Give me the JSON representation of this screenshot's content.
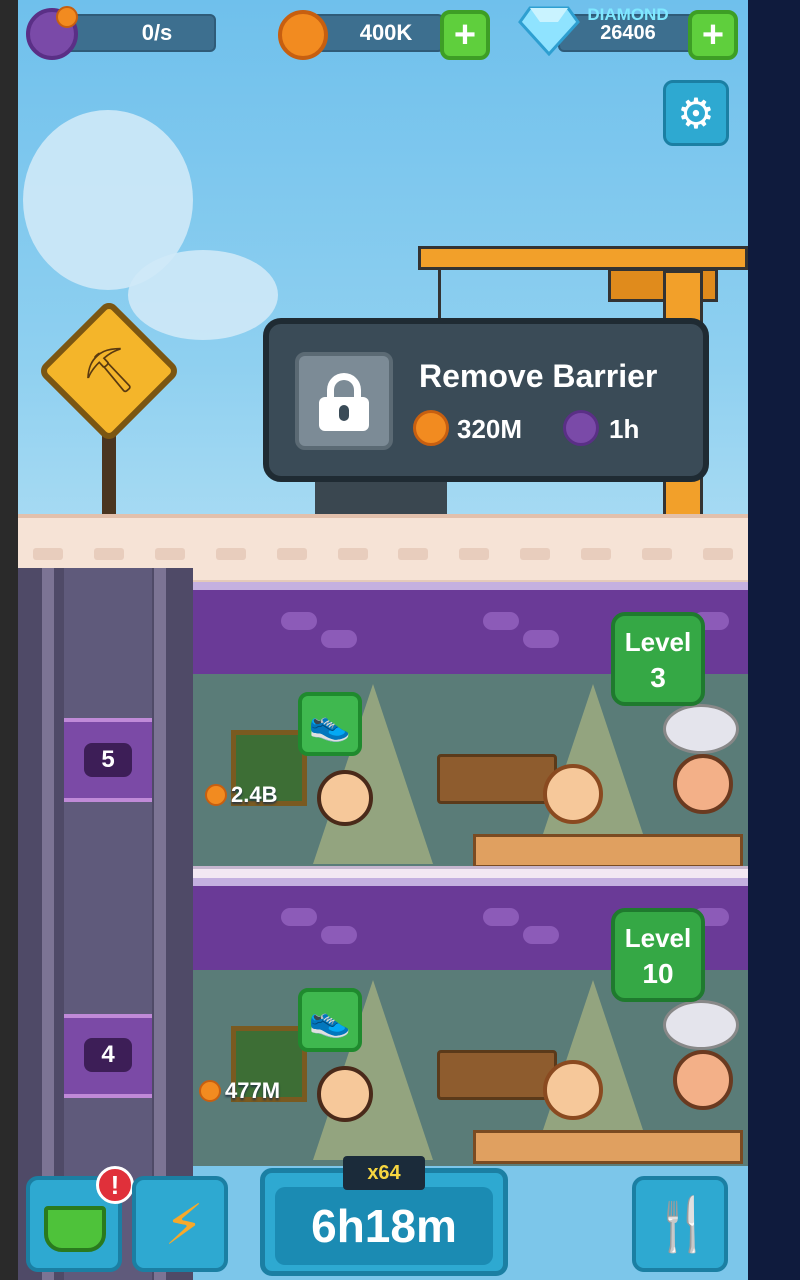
{
  "hud": {
    "income_rate": "0/s",
    "coins": "400K",
    "diamond_label": "DIAMOND",
    "diamonds": "26406",
    "plus": "+"
  },
  "barrier": {
    "title": "Remove Barrier",
    "cost": "320M",
    "time": "1h"
  },
  "floors": [
    {
      "number": "5",
      "level_label": "Level",
      "level": "3",
      "earning": "2.4B"
    },
    {
      "number": "4",
      "level_label": "Level",
      "level": "10",
      "earning": "477M"
    }
  ],
  "bottom": {
    "alert": "!",
    "multiplier": "x64",
    "timer": "6h18m"
  },
  "colors": {
    "sky": "#7cc6ea",
    "panel": "#3a4b57",
    "accent_green": "#35a845",
    "button_blue": "#2ea9d1",
    "floor_purple": "#6a3a97"
  },
  "icons": {
    "income": "purple-clock-coin-icon",
    "coin": "gold-coin-icon",
    "diamond": "diamond-icon",
    "settings": "gear-icon",
    "lock": "lock-icon",
    "shoe": "shoe-icon",
    "basket": "basket-icon",
    "boost": "lightning-icon",
    "menu": "fork-spoon-icon"
  }
}
